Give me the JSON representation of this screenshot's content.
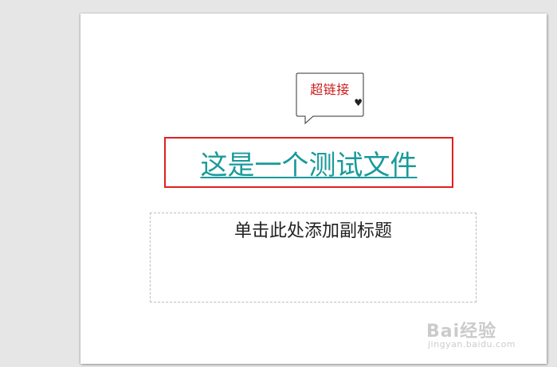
{
  "slide": {
    "callout_text": "超链接",
    "callout_icon": "heart-icon",
    "title_link_text": "这是一个测试文件",
    "subtitle_placeholder": "单击此处添加副标题",
    "colors": {
      "title_link": "#1a9a9a",
      "highlight_border": "#e02020",
      "callout_text": "#cc1a1a"
    }
  },
  "watermark": {
    "logo_text": "Bai经验",
    "url_text": "jingyan.baidu.com"
  }
}
